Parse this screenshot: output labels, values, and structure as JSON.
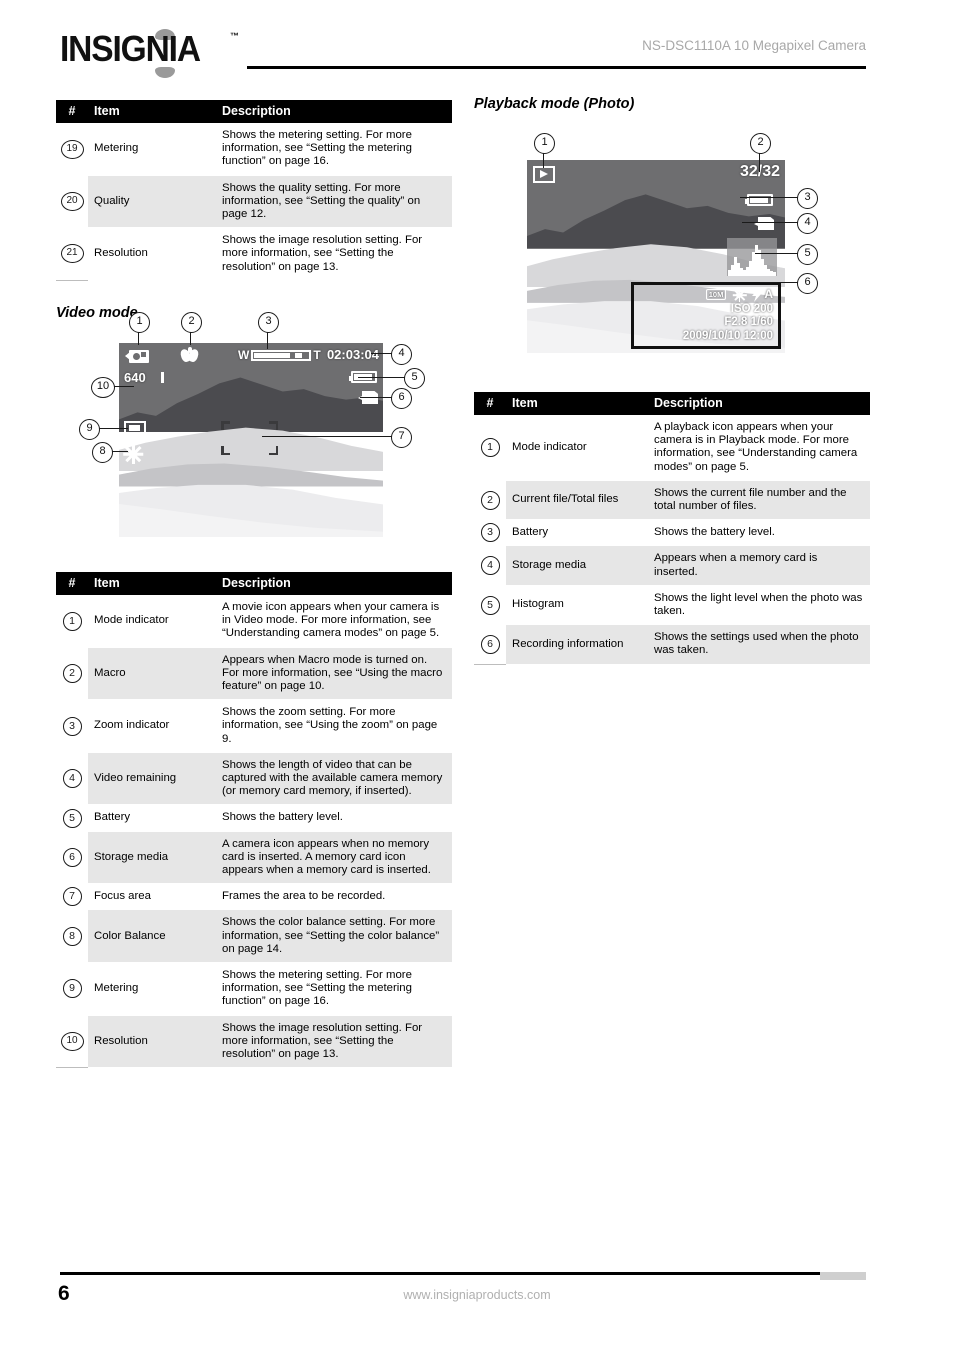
{
  "header": {
    "logo_text": "INSIGNIA",
    "logo_tm": "™",
    "title": "NS-DSC1110A 10 Megapixel Camera"
  },
  "footer": {
    "page_number": "6",
    "url": "www.insigniaproducts.com"
  },
  "table_top": {
    "columns": [
      "#",
      "Item",
      "Description"
    ],
    "rows": [
      {
        "num": "19",
        "item": "Metering",
        "desc": "Shows the metering setting. For more information, see “Setting the metering function” on page 16."
      },
      {
        "num": "20",
        "item": "Quality",
        "desc": "Shows the quality setting. For more information, see “Setting the quality” on page 12."
      },
      {
        "num": "21",
        "item": "Resolution",
        "desc": "Shows the image resolution setting. For more information, see “Setting the resolution” on page 13."
      }
    ]
  },
  "video_mode": {
    "heading": "Video mode",
    "screen": {
      "time_remaining": "02:03:04",
      "resolution_badge": "640",
      "zoom_wide_label": "W",
      "zoom_tele_label": "T"
    },
    "callouts": [
      "1",
      "2",
      "3",
      "4",
      "5",
      "6",
      "7",
      "8",
      "9",
      "10"
    ]
  },
  "table_video": {
    "columns": [
      "#",
      "Item",
      "Description"
    ],
    "rows": [
      {
        "num": "1",
        "item": "Mode indicator",
        "desc": "A movie icon appears when your camera is in Video mode. For more information, see “Understanding camera modes” on page 5."
      },
      {
        "num": "2",
        "item": "Macro",
        "desc": "Appears when Macro mode is turned on. For more information, see “Using the macro feature” on page 10."
      },
      {
        "num": "3",
        "item": "Zoom indicator",
        "desc": "Shows the zoom setting. For more information, see “Using the zoom” on page 9."
      },
      {
        "num": "4",
        "item": "Video remaining",
        "desc": "Shows the length of video that can be captured with the available camera memory (or memory card memory, if inserted)."
      },
      {
        "num": "5",
        "item": "Battery",
        "desc": "Shows the battery level."
      },
      {
        "num": "6",
        "item": "Storage media",
        "desc": "A camera icon appears when no memory card is inserted. A memory card icon appears when a memory card is inserted."
      },
      {
        "num": "7",
        "item": "Focus area",
        "desc": "Frames the area to be recorded."
      },
      {
        "num": "8",
        "item": "Color Balance",
        "desc": "Shows the color balance setting. For more information, see “Setting the color balance” on page 14."
      },
      {
        "num": "9",
        "item": "Metering",
        "desc": "Shows the metering setting. For more information, see “Setting the metering function” on page 16."
      },
      {
        "num": "10",
        "item": "Resolution",
        "desc": "Shows the image resolution setting. For more information, see “Setting the resolution” on page 13."
      }
    ]
  },
  "playback_mode": {
    "heading": "Playback mode (Photo)",
    "screen": {
      "file_counter": "32/32",
      "resolution_badge": "10M",
      "flash_label": "A",
      "iso": "ISO 200",
      "exposure": "F2.8  1/60",
      "datetime": "2009/10/10 12:00"
    },
    "callouts": [
      "1",
      "2",
      "3",
      "4",
      "5",
      "6"
    ]
  },
  "table_playback": {
    "columns": [
      "#",
      "Item",
      "Description"
    ],
    "rows": [
      {
        "num": "1",
        "item": "Mode indicator",
        "desc": "A playback icon appears when your camera is in Playback mode. For more information, see “Understanding camera modes” on page 5."
      },
      {
        "num": "2",
        "item": "Current file/Total files",
        "desc": "Shows the current file number and the total number of files."
      },
      {
        "num": "3",
        "item": "Battery",
        "desc": "Shows the battery level."
      },
      {
        "num": "4",
        "item": "Storage media",
        "desc": "Appears when a memory card is inserted."
      },
      {
        "num": "5",
        "item": "Histogram",
        "desc": "Shows the light level when the photo was taken."
      },
      {
        "num": "6",
        "item": "Recording information",
        "desc": "Shows the settings used when the photo was taken."
      }
    ]
  }
}
